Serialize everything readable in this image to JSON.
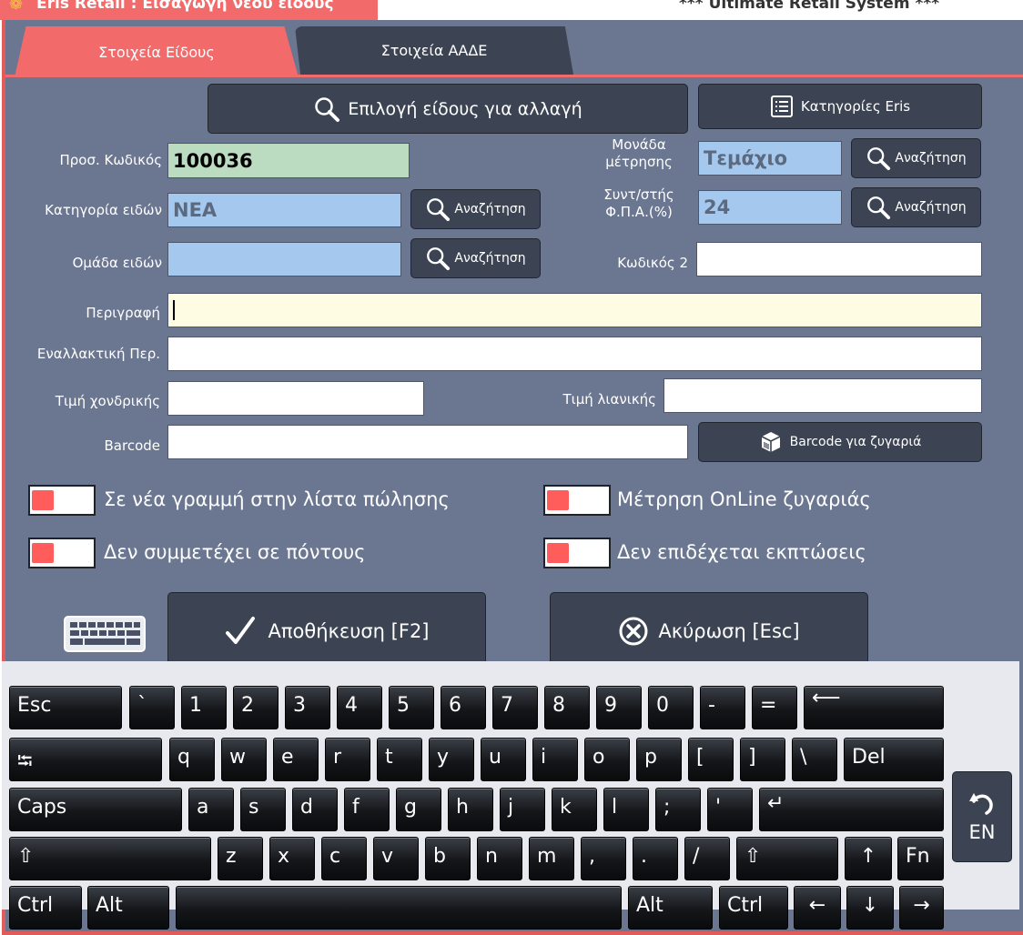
{
  "titlebar": {
    "app_title": "Eris Retail : Εισαγωγή νέου είδους",
    "system_name": "*** Ultimate Retail System ***"
  },
  "tabs": [
    {
      "label": "Στοιχεία Είδους",
      "active": true
    },
    {
      "label": "Στοιχεία ΑΑΔΕ",
      "active": false
    }
  ],
  "buttons": {
    "select_item": "Επιλογή είδους για αλλαγή",
    "categories": "Κατηγορίες Eris",
    "search": "Αναζήτηση",
    "barcode_scale": "Barcode για ζυγαριά",
    "save": "Αποθήκευση [F2]",
    "cancel": "Ακύρωση [Esc]"
  },
  "form": {
    "code_label": "Προσ. Κωδικός",
    "code_value": "100036",
    "category_label": "Κατηγορία ειδών",
    "category_value": "ΝΕΑ",
    "group_label": "Ομάδα ειδών",
    "group_value": "",
    "unit_label_1": "Μονάδα",
    "unit_label_2": "μέτρησης",
    "unit_value": "Τεμάχιο",
    "vat_label_1": "Συντ/στής",
    "vat_label_2": "Φ.Π.Α.(%)",
    "vat_value": "24",
    "code2_label": "Κωδικός 2",
    "code2_value": "",
    "description_label": "Περιγραφή",
    "description_value": "",
    "alt_description_label": "Εναλλακτική Περ.",
    "alt_description_value": "",
    "wholesale_label": "Τιμή χονδρικής",
    "wholesale_value": "",
    "retail_label": "Τιμή λιανικής",
    "retail_value": "",
    "barcode_label": "Barcode",
    "barcode_value": ""
  },
  "toggles": {
    "new_line": "Σε νέα γραμμή στην λίστα πώλησης",
    "online_scale": "Μέτρηση OnLine ζυγαριάς",
    "no_points": "Δεν συμμετέχει σε πόντους",
    "no_discounts": "Δεν επιδέχεται εκπτώσεις"
  },
  "keyboard": {
    "row1": [
      "Esc",
      "`",
      "1",
      "2",
      "3",
      "4",
      "5",
      "6",
      "7",
      "8",
      "9",
      "0",
      "-",
      "=",
      "⟵"
    ],
    "row2": [
      "⭾",
      "q",
      "w",
      "e",
      "r",
      "t",
      "y",
      "u",
      "i",
      "o",
      "p",
      "[",
      "]",
      "\\",
      "Del"
    ],
    "row3": [
      "Caps",
      "a",
      "s",
      "d",
      "f",
      "g",
      "h",
      "j",
      "k",
      "l",
      ";",
      "'",
      "↵"
    ],
    "row4": [
      "⇧",
      "z",
      "x",
      "c",
      "v",
      "b",
      "n",
      "m",
      ",",
      ".",
      "/",
      "⇧",
      "↑",
      "Fn"
    ],
    "row5": [
      "Ctrl",
      "Alt",
      "",
      "Alt",
      "Ctrl",
      "←",
      "↓",
      "→"
    ],
    "language": "EN"
  },
  "colors": {
    "accent": "#f26a6a",
    "panel": "#6b7690",
    "button": "#3c4453"
  }
}
